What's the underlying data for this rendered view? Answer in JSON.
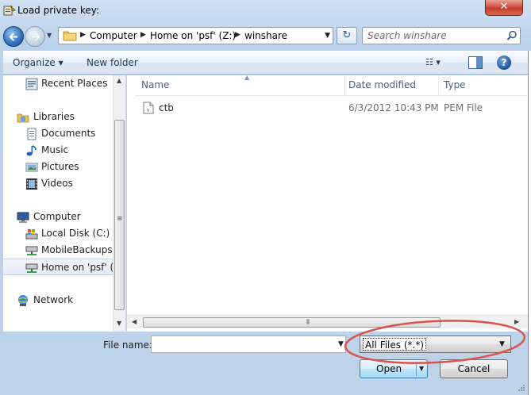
{
  "window": {
    "title": "Load private key:",
    "close_label": "✕"
  },
  "address": {
    "crumbs": [
      "Computer",
      "Home on 'psf' (Z:)",
      "winshare"
    ],
    "refresh_glyph": "↻"
  },
  "search": {
    "placeholder": "Search winshare"
  },
  "toolbar": {
    "organize_label": "Organize ▾",
    "new_folder_label": "New folder",
    "views_label": "☷ ▾",
    "help_label": "?"
  },
  "nav": {
    "items": [
      {
        "label": "Recent Places",
        "icon": "recent-places-icon"
      },
      {
        "label": "Libraries",
        "icon": "libraries-icon"
      },
      {
        "label": "Documents",
        "icon": "documents-icon"
      },
      {
        "label": "Music",
        "icon": "music-icon"
      },
      {
        "label": "Pictures",
        "icon": "pictures-icon"
      },
      {
        "label": "Videos",
        "icon": "videos-icon"
      },
      {
        "label": "Computer",
        "icon": "computer-icon"
      },
      {
        "label": "Local Disk (C:)",
        "icon": "local-disk-icon"
      },
      {
        "label": "MobileBackups c",
        "icon": "network-drive-icon"
      },
      {
        "label": "Home on 'psf' (Z",
        "icon": "network-drive-icon"
      },
      {
        "label": "Network",
        "icon": "network-icon"
      }
    ],
    "selected": "Home on 'psf' (Z"
  },
  "columns": {
    "name": "Name",
    "date": "Date modified",
    "type": "Type"
  },
  "files": [
    {
      "name": "ctb",
      "date": "6/3/2012 10:43 PM",
      "type": "PEM File"
    }
  ],
  "bottom": {
    "filename_label": "File name:",
    "filename_value": "",
    "filetype_value": "All Files (*.*)",
    "open_label": "Open",
    "cancel_label": "Cancel"
  },
  "colors": {
    "frame": "#bed3ea",
    "annotation": "#d9534a",
    "accent": "#1c4f9c"
  }
}
